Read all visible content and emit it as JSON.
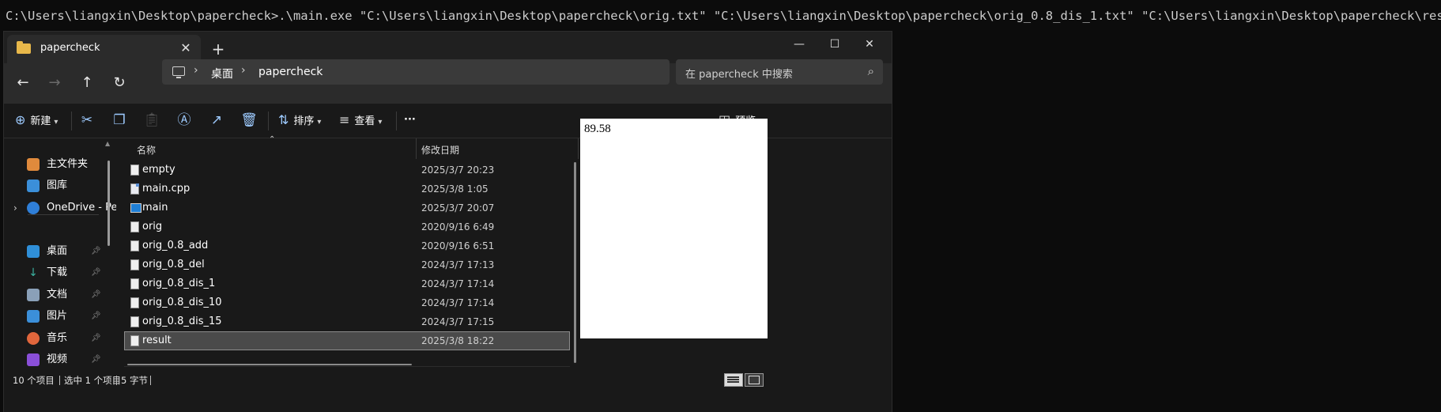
{
  "terminal": {
    "command_line": "C:\\Users\\liangxin\\Desktop\\papercheck>.\\main.exe \"C:\\Users\\liangxin\\Desktop\\papercheck\\orig.txt\" \"C:\\Users\\liangxin\\Desktop\\papercheck\\orig_0.8_dis_1.txt\" \"C:\\Users\\liangxin\\Desktop\\papercheck\\result.txt\""
  },
  "window": {
    "tab_title": "papercheck",
    "close_tab": "✕",
    "new_tab": "+",
    "minimize": "—",
    "maximize": "☐",
    "close_window": "✕"
  },
  "nav": {
    "back": "←",
    "forward": "→",
    "up": "↑",
    "refresh": "↻",
    "breadcrumb_sep": "›",
    "breadcrumbs": [
      "桌面",
      "papercheck"
    ],
    "search_placeholder": "在 papercheck 中搜索"
  },
  "toolbar": {
    "new_label": "新建",
    "sort_label": "排序",
    "view_label": "查看",
    "more_label": "···",
    "preview_label": "预览"
  },
  "sidebar": {
    "items": [
      {
        "label": "主文件夹",
        "icon": "home-icon",
        "color": "#e08a3c"
      },
      {
        "label": "图库",
        "icon": "gallery-icon",
        "color": "#3b8fd9"
      },
      {
        "label": "OneDrive - Per",
        "icon": "onedrive-icon",
        "color": "#2f7fd8"
      },
      {
        "label": "桌面",
        "icon": "desktop-icon",
        "color": "#2f8fd8"
      },
      {
        "label": "下载",
        "icon": "download-icon",
        "color": "#3bb3a0"
      },
      {
        "label": "文档",
        "icon": "document-icon",
        "color": "#8aa0b8"
      },
      {
        "label": "图片",
        "icon": "pictures-icon",
        "color": "#3b8fd9"
      },
      {
        "label": "音乐",
        "icon": "music-icon",
        "color": "#e0663c"
      },
      {
        "label": "视频",
        "icon": "video-icon",
        "color": "#8a4fd8"
      }
    ]
  },
  "list": {
    "col_name": "名称",
    "col_date": "修改日期",
    "files": [
      {
        "name": "empty",
        "date": "2025/3/7 20:23",
        "kind": "txt"
      },
      {
        "name": "main.cpp",
        "date": "2025/3/8 1:05",
        "kind": "cpp"
      },
      {
        "name": "main",
        "date": "2025/3/7 20:07",
        "kind": "exe"
      },
      {
        "name": "orig",
        "date": "2020/9/16 6:49",
        "kind": "txt"
      },
      {
        "name": "orig_0.8_add",
        "date": "2020/9/16 6:51",
        "kind": "txt"
      },
      {
        "name": "orig_0.8_del",
        "date": "2024/3/7 17:13",
        "kind": "txt"
      },
      {
        "name": "orig_0.8_dis_1",
        "date": "2024/3/7 17:14",
        "kind": "txt"
      },
      {
        "name": "orig_0.8_dis_10",
        "date": "2024/3/7 17:14",
        "kind": "txt"
      },
      {
        "name": "orig_0.8_dis_15",
        "date": "2024/3/7 17:15",
        "kind": "txt"
      },
      {
        "name": "result",
        "date": "2025/3/8 18:22",
        "kind": "txt"
      }
    ],
    "selected": "result"
  },
  "preview": {
    "content": "89.58"
  },
  "status": {
    "count": "10 个项目",
    "selection": "选中 1 个项目",
    "size": "5 字节"
  },
  "colors": {
    "accent": "#9ecbff",
    "window_bg": "#191919",
    "terminal_bg": "#0c0c0c"
  }
}
